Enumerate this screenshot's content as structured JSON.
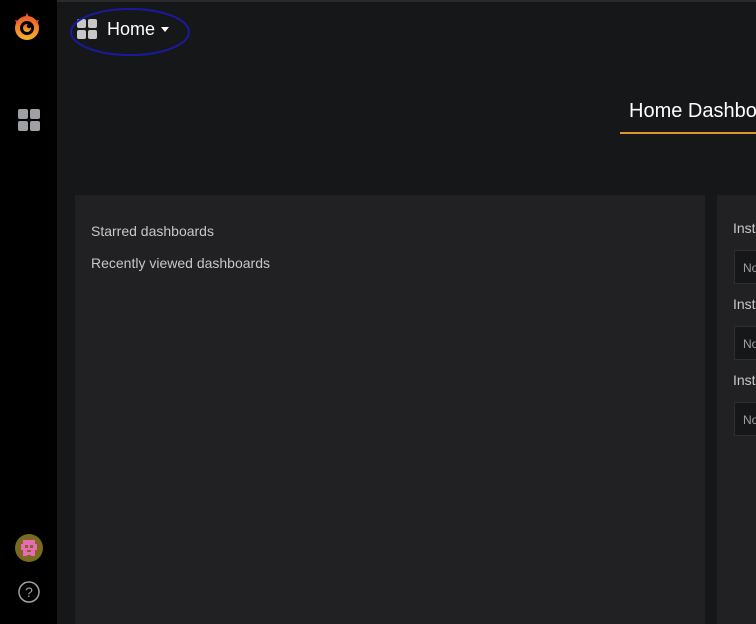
{
  "nav": {
    "title": "Home",
    "dashboard_title": "Home Dashbo"
  },
  "icons": {
    "logo": "grafana-logo-icon",
    "dashboards": "dashboards-grid-icon",
    "avatar": "user-avatar",
    "help": "help-icon",
    "caret": "caret-down-icon"
  },
  "left_panel": {
    "starred": "Starred dashboards",
    "recent": "Recently viewed dashboards"
  },
  "right_panel": {
    "items": [
      {
        "label": "Inst",
        "value": "No"
      },
      {
        "label": "Inst",
        "value": "No"
      },
      {
        "label": "Inst",
        "value": "No"
      }
    ]
  },
  "colors": {
    "sidebar": "#000000",
    "background": "#161719",
    "panel": "#212124",
    "accent": "#e0952c",
    "annotation": "#1a1a9e"
  }
}
